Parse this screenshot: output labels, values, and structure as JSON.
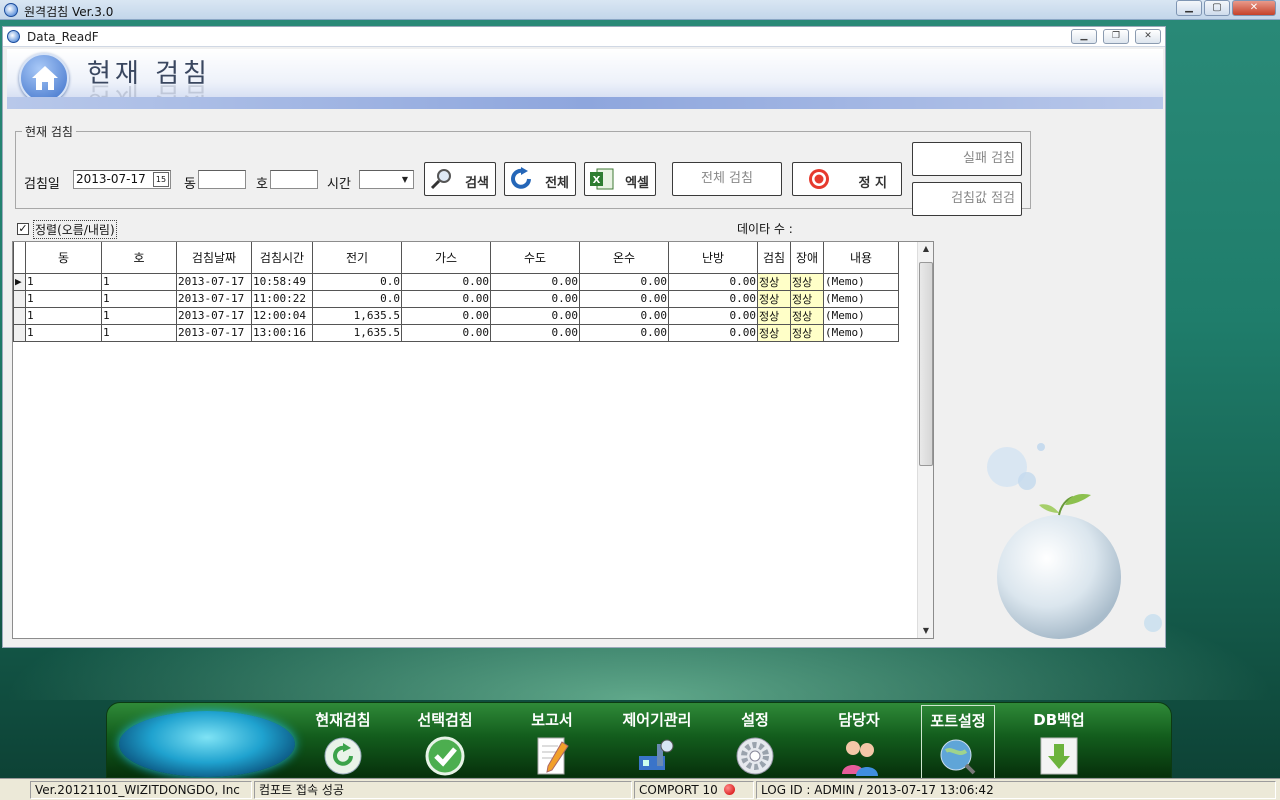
{
  "app": {
    "title": "원격검침 Ver.3.0"
  },
  "child": {
    "title": "Data_ReadF"
  },
  "banner": {
    "title": "현재 검침"
  },
  "search": {
    "group_label": "현재 검침",
    "date_label": "검침일",
    "date_value": "2013-07-17",
    "dong_label": "동",
    "ho_label": "호",
    "time_label": "시간",
    "search_btn": "검색",
    "all_btn": "전체",
    "excel_btn": "엑셀",
    "read_all_btn": "전체 검침",
    "stop_btn": "정 지",
    "fail_read_btn": "실패 검침",
    "check_values_btn": "검침값 점검"
  },
  "options": {
    "sort_label": "정렬(오름/내림)",
    "sort_checked": true,
    "data_count_label": "데이타 수 :"
  },
  "grid": {
    "columns": [
      "동",
      "호",
      "검침날짜",
      "검침시간",
      "전기",
      "가스",
      "수도",
      "온수",
      "난방",
      "검침",
      "장애",
      "내용"
    ],
    "rows": [
      [
        "1",
        "1",
        "2013-07-17",
        "10:58:49",
        "0.0",
        "0.00",
        "0.00",
        "0.00",
        "0.00",
        "정상",
        "정상",
        "(Memo)"
      ],
      [
        "1",
        "1",
        "2013-07-17",
        "11:00:22",
        "0.0",
        "0.00",
        "0.00",
        "0.00",
        "0.00",
        "정상",
        "정상",
        "(Memo)"
      ],
      [
        "1",
        "1",
        "2013-07-17",
        "12:00:04",
        "1,635.5",
        "0.00",
        "0.00",
        "0.00",
        "0.00",
        "정상",
        "정상",
        "(Memo)"
      ],
      [
        "1",
        "1",
        "2013-07-17",
        "13:00:16",
        "1,635.5",
        "0.00",
        "0.00",
        "0.00",
        "0.00",
        "정상",
        "정상",
        "(Memo)"
      ]
    ]
  },
  "taskbar": {
    "items": [
      {
        "label": "현재검침",
        "icon": "refresh-icon"
      },
      {
        "label": "선택검침",
        "icon": "check-icon"
      },
      {
        "label": "보고서",
        "icon": "report-icon"
      },
      {
        "label": "제어기관리",
        "icon": "controller-icon"
      },
      {
        "label": "설정",
        "icon": "gear-icon"
      },
      {
        "label": "담당자",
        "icon": "users-icon"
      },
      {
        "label": "포트설정",
        "icon": "globe-icon"
      },
      {
        "label": "DB백업",
        "icon": "download-icon"
      }
    ],
    "selected": "포트설정"
  },
  "status": {
    "version": "Ver.20121101_WIZITDONGDO, Inc",
    "message": "컴포트 접속 성공",
    "comport": "COMPORT 10",
    "login": "LOG ID : ADMIN / 2013-07-17 13:06:42"
  },
  "colors": {
    "accent": "#3b6fc9",
    "ok_cell": "#ffffc8",
    "taskbar": "#135d1d",
    "status_dot": "#d00000"
  }
}
